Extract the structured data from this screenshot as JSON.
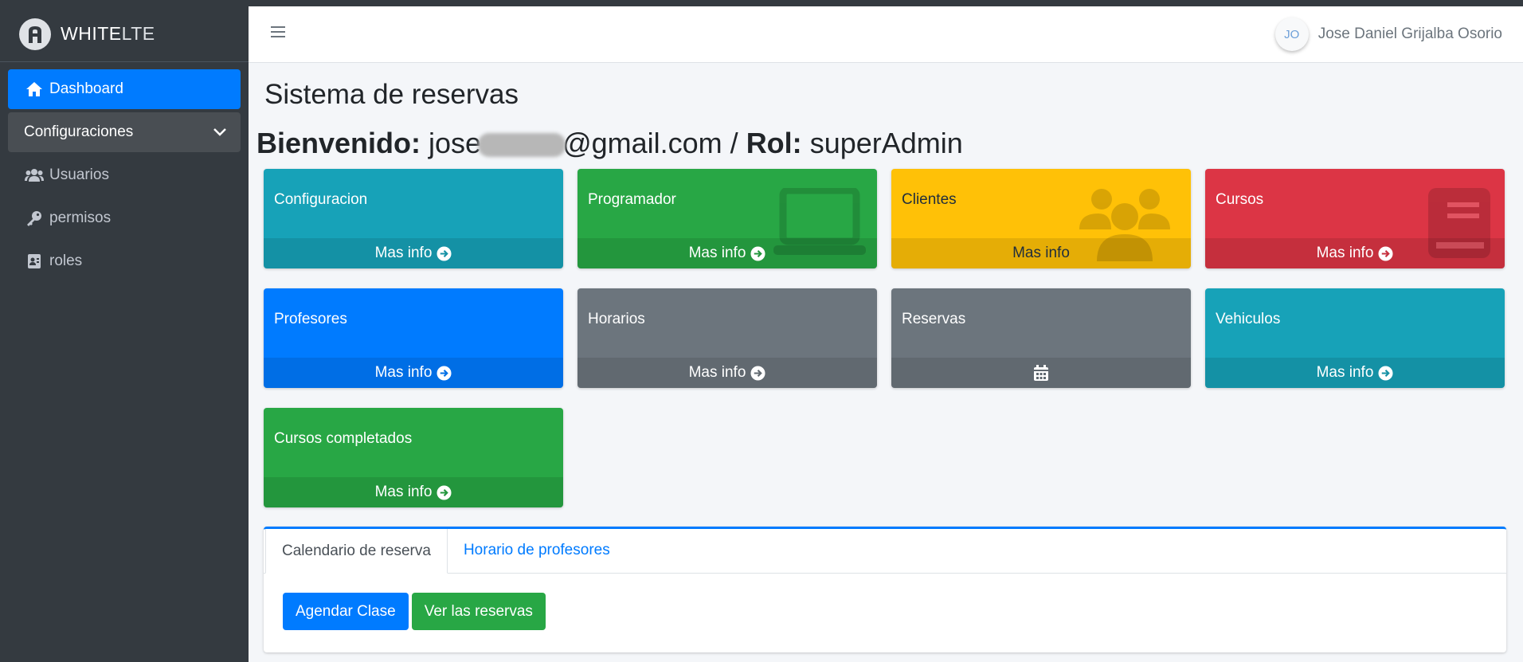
{
  "sidebar": {
    "brand_bold": "WHITE",
    "brand_light": "LTE",
    "items": [
      {
        "label": "Dashboard"
      },
      {
        "label": "Configuraciones"
      },
      {
        "label": "Usuarios"
      },
      {
        "label": "permisos"
      },
      {
        "label": "roles"
      }
    ]
  },
  "header": {
    "avatar_initials": "JO",
    "user_name": "Jose Daniel Grijalba Osorio"
  },
  "main": {
    "title": "Sistema de reservas",
    "welcome_label": "Bienvenido:",
    "email_start": "jose",
    "email_end": "@gmail.com /",
    "role_label": "Rol:",
    "role_value": "superAdmin"
  },
  "boxes": [
    {
      "title": "Configuracion",
      "footer": "Mas info"
    },
    {
      "title": "Programador",
      "footer": "Mas info"
    },
    {
      "title": "Clientes",
      "footer": "Mas info"
    },
    {
      "title": "Cursos",
      "footer": "Mas info"
    },
    {
      "title": "Profesores",
      "footer": "Mas info"
    },
    {
      "title": "Horarios",
      "footer": "Mas info"
    },
    {
      "title": "Reservas",
      "footer": ""
    },
    {
      "title": "Vehiculos",
      "footer": "Mas info"
    },
    {
      "title": "Cursos completados",
      "footer": "Mas info"
    }
  ],
  "tabs": [
    {
      "label": "Calendario de reserva"
    },
    {
      "label": "Horario de profesores"
    }
  ],
  "buttons": {
    "agendar": "Agendar Clase",
    "ver": "Ver las reservas"
  },
  "colors": {
    "info": "#17a2b8",
    "success": "#28a745",
    "warning": "#ffc107",
    "danger": "#dc3545",
    "primary": "#007bff",
    "secondary": "#6c757d",
    "sidebar": "#343a40"
  }
}
